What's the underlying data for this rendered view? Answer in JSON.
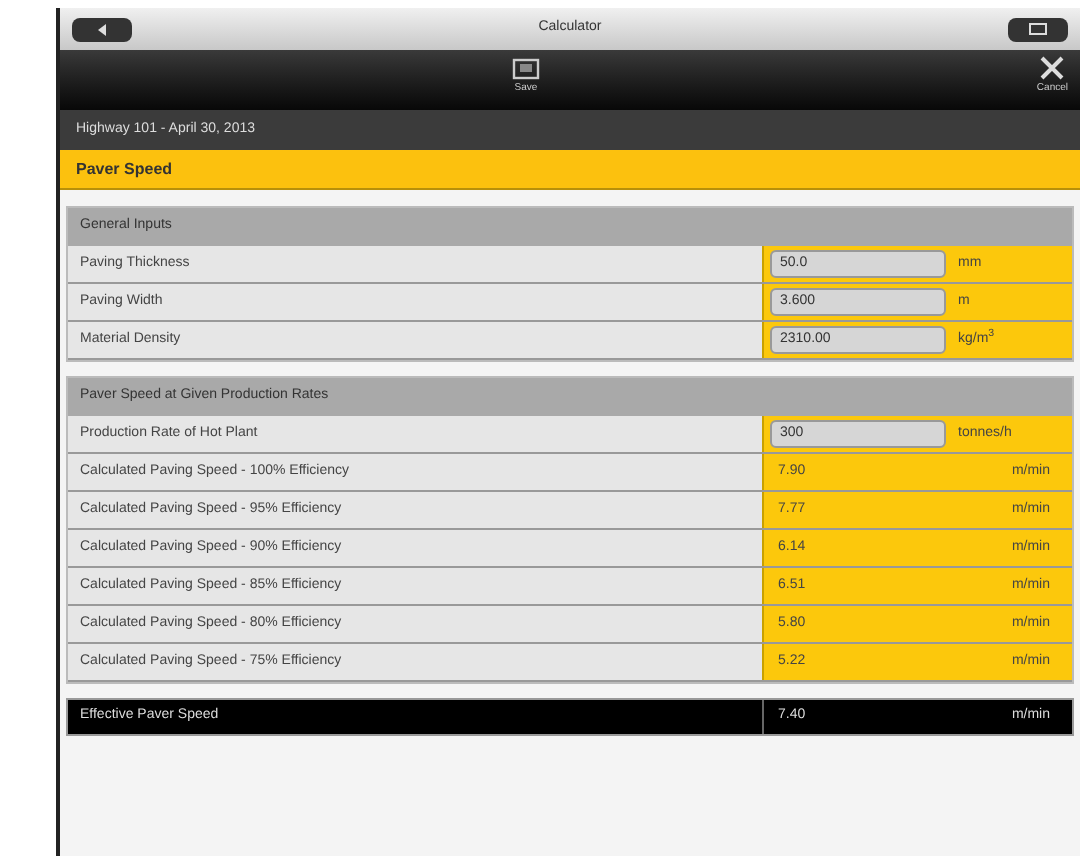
{
  "window": {
    "title": "Calculator"
  },
  "toolbar": [
    {
      "kind": "save",
      "label": "Save"
    },
    {
      "kind": "cancel",
      "label": "Cancel"
    }
  ],
  "subtitle": "Highway 101 - April 30, 2013",
  "page_title": "Paver Speed",
  "sections": [
    {
      "title": "General Inputs",
      "rows": [
        {
          "kind": "input",
          "label": "Paving Thickness",
          "value": "50.0",
          "unit": "mm"
        },
        {
          "kind": "input",
          "label": "Paving Width",
          "value": "3.600",
          "unit": "m"
        },
        {
          "kind": "input",
          "label": "Material Density",
          "value": "2310.00",
          "unit": "kg/m$^{3}$"
        }
      ]
    },
    {
      "title": "Paver Speed at Given Production Rates",
      "rows": [
        {
          "kind": "input",
          "label": "Production Rate of Hot Plant",
          "value": "300",
          "unit": "tonnes/h"
        },
        {
          "kind": "output",
          "label": "Calculated Paving Speed - 100% Efficiency",
          "value": "7.90",
          "unit": "m/min"
        },
        {
          "kind": "output",
          "label": "Calculated Paving Speed - 95% Efficiency",
          "value": "7.77",
          "unit": "m/min"
        },
        {
          "kind": "output",
          "label": "Calculated Paving Speed - 90% Efficiency",
          "value": "6.14",
          "unit": "m/min"
        },
        {
          "kind": "output",
          "label": "Calculated Paving Speed - 85% Efficiency",
          "value": "6.51",
          "unit": "m/min"
        },
        {
          "kind": "output",
          "label": "Calculated Paving Speed - 80% Efficiency",
          "value": "5.80",
          "unit": "m/min"
        },
        {
          "kind": "output",
          "label": "Calculated Paving Speed - 75% Efficiency",
          "value": "5.22",
          "unit": "m/min"
        }
      ]
    }
  ],
  "result": {
    "label": "Effective Paver Speed",
    "value": "7.40",
    "unit": "m/min"
  }
}
